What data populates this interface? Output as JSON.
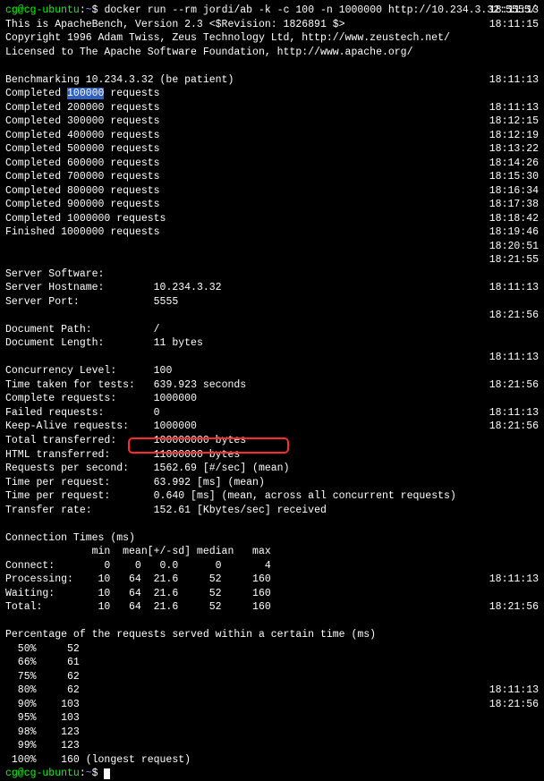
{
  "prompt": {
    "user_host": "cg@cg-ubuntu",
    "colon": ":",
    "path": "~",
    "dollar": "$ ",
    "command": "docker run --rm jordi/ab -k -c 100 -n 1000000 http://10.234.3.32:5555/"
  },
  "header": {
    "ab_line": "This is ApacheBench, Version 2.3 <$Revision: 1826891 $>",
    "copyright": "Copyright 1996 Adam Twiss, Zeus Technology Ltd, http://www.zeustech.net/",
    "license": "Licensed to The Apache Software Foundation, http://www.apache.org/"
  },
  "bench_start": "Benchmarking 10.234.3.32 (be patient)",
  "completed_prefix": "Completed ",
  "completed_suffix": " requests",
  "completed_first_count": "100000",
  "completed_counts": [
    "200000",
    "300000",
    "400000",
    "500000",
    "600000",
    "700000",
    "800000",
    "900000",
    "1000000"
  ],
  "finished": "Finished 1000000 requests",
  "server": {
    "software_label": "Server Software:",
    "software_value": "",
    "hostname_label": "Server Hostname:",
    "hostname_value": "10.234.3.32",
    "port_label": "Server Port:",
    "port_value": "5555"
  },
  "document": {
    "path_label": "Document Path:",
    "path_value": "/",
    "length_label": "Document Length:",
    "length_value": "11 bytes"
  },
  "results": {
    "concurrency_label": "Concurrency Level:",
    "concurrency_value": "100",
    "time_taken_label": "Time taken for tests:",
    "time_taken_value": "639.923 seconds",
    "complete_label": "Complete requests:",
    "complete_value": "1000000",
    "failed_label": "Failed requests:",
    "failed_value": "0",
    "keepalive_label": "Keep-Alive requests:",
    "keepalive_value": "1000000",
    "total_label": "Total transferred:",
    "total_value": "100000000 bytes",
    "html_label": "HTML transferred:",
    "html_value": "11000000 bytes",
    "rps_label": "Requests per second:",
    "rps_value": "1562.69 [#/sec] (mean)",
    "tpr1_label": "Time per request:",
    "tpr1_value": "63.992 [ms] (mean)",
    "tpr2_label": "Time per request:",
    "tpr2_value": "0.640 [ms] (mean, across all concurrent requests)",
    "rate_label": "Transfer rate:",
    "rate_value": "152.61 [Kbytes/sec] received"
  },
  "conn_times": {
    "title": "Connection Times (ms)",
    "header": "              min  mean[+/-sd] median   max",
    "connect": "Connect:        0    0   0.0      0       4",
    "processing": "Processing:    10   64  21.6     52     160",
    "waiting": "Waiting:       10   64  21.6     52     160",
    "total": "Total:         10   64  21.6     52     160"
  },
  "percentiles": {
    "title": "Percentage of the requests served within a certain time (ms)",
    "p50": "  50%     52",
    "p66": "  66%     61",
    "p75": "  75%     62",
    "p80": "  80%     62",
    "p90": "  90%    103",
    "p95": "  95%    103",
    "p98": "  98%    123",
    "p99": "  99%    123",
    "p100": " 100%    160 (longest request)"
  },
  "timestamps_right": [
    "18:11:13",
    "18:11:15",
    "",
    "",
    "",
    "18:11:13",
    "",
    "18:11:13",
    "18:12:15",
    "18:12:19",
    "18:13:22",
    "18:14:26",
    "18:15:30",
    "18:16:34",
    "18:17:38",
    "18:18:42",
    "18:19:46",
    "18:20:51",
    "18:21:55",
    "",
    "18:11:13",
    "",
    "18:21:56",
    "",
    "",
    "18:11:13",
    "",
    "18:21:56",
    "",
    "18:11:13",
    "18:21:56",
    "",
    "",
    "",
    "",
    "",
    "",
    "",
    "",
    "",
    "",
    "18:11:13",
    "",
    "18:21:56",
    "",
    "",
    "",
    "",
    "",
    "18:11:13",
    "18:21:56"
  ],
  "prompt2": {
    "user_host": "cg@cg-ubuntu",
    "path": "~",
    "dollar": "$ "
  }
}
